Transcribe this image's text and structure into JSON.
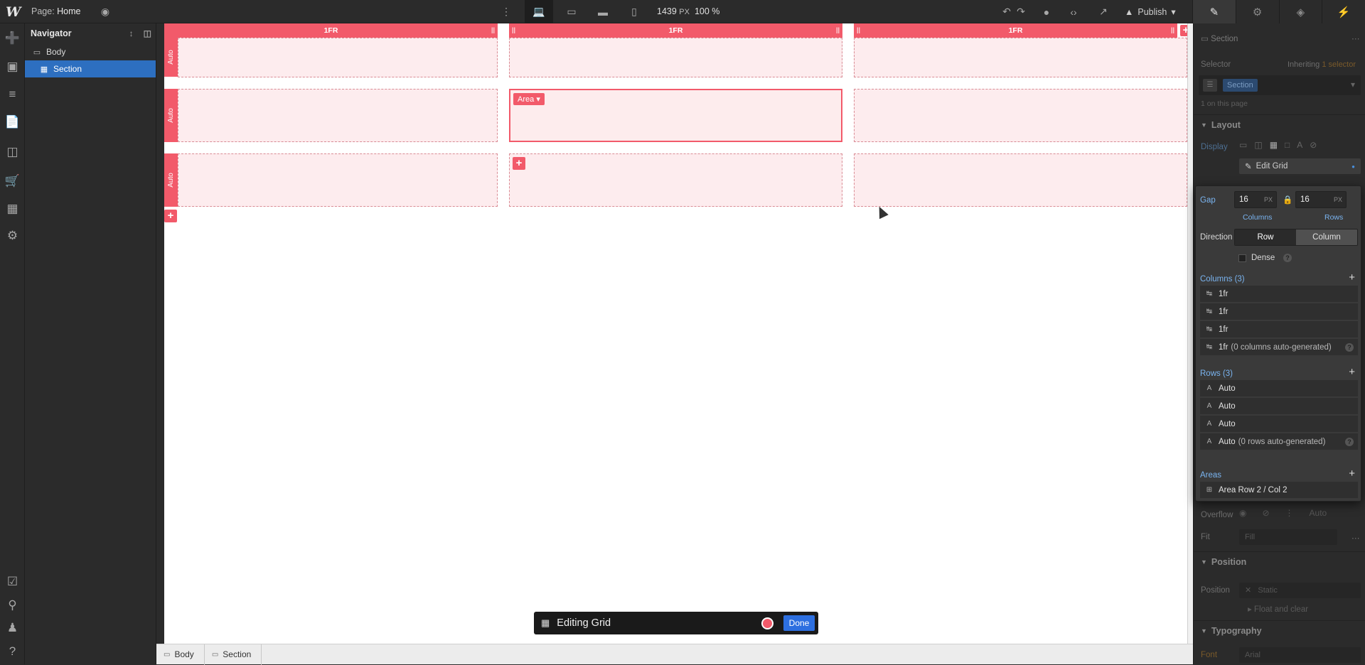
{
  "topbar": {
    "logo": "W",
    "page_label": "Page:",
    "page_name": "Home",
    "width_value": "1439",
    "width_unit": "PX",
    "zoom": "100 %",
    "publish_label": "Publish"
  },
  "navigator": {
    "title": "Navigator",
    "items": [
      {
        "label": "Body"
      },
      {
        "label": "Section"
      }
    ]
  },
  "canvas": {
    "columns": [
      "1FR",
      "1FR",
      "1FR"
    ],
    "rows": [
      "Auto",
      "Auto",
      "Auto"
    ],
    "area_tag": "Area",
    "editing_label": "Editing Grid",
    "done_label": "Done"
  },
  "breadcrumbs": [
    "Body",
    "Section"
  ],
  "style_panel": {
    "element": "Section",
    "selector_label": "Selector",
    "inheriting_text": "Inheriting",
    "inheriting_count": "1 selector",
    "selector_chip": "Section",
    "on_page": "1 on this page",
    "layout_title": "Layout",
    "display_label": "Display",
    "edit_grid_label": "Edit Grid",
    "overflow_label": "Overflow",
    "overflow_auto": "Auto",
    "fit_label": "Fit",
    "fit_value": "Fill",
    "position_title": "Position",
    "position_label": "Position",
    "position_value": "Static",
    "float_clear": "Float and clear",
    "typography_title": "Typography",
    "font_label": "Font",
    "font_value": "Arial"
  },
  "grid_settings": {
    "gap_label": "Gap",
    "gap_columns": "16",
    "gap_rows": "16",
    "gap_unit": "PX",
    "columns_caption": "Columns",
    "rows_caption": "Rows",
    "direction_label": "Direction",
    "direction_row": "Row",
    "direction_column": "Column",
    "dense_label": "Dense",
    "columns_title": "Columns (3)",
    "column_items": [
      "1fr",
      "1fr",
      "1fr",
      "1fr"
    ],
    "column_auto_note": "(0 columns auto-generated)",
    "rows_title": "Rows (3)",
    "row_items": [
      "Auto",
      "Auto",
      "Auto",
      "Auto"
    ],
    "row_auto_note": "(0 rows auto-generated)",
    "areas_title": "Areas",
    "area_items": [
      "Area Row 2 / Col 2"
    ]
  },
  "colors": {
    "grid_accent": "#f25a6a",
    "cell_fill": "#fdecee",
    "selection_blue": "#2d6fc0",
    "done_blue": "#2d6fe0"
  }
}
